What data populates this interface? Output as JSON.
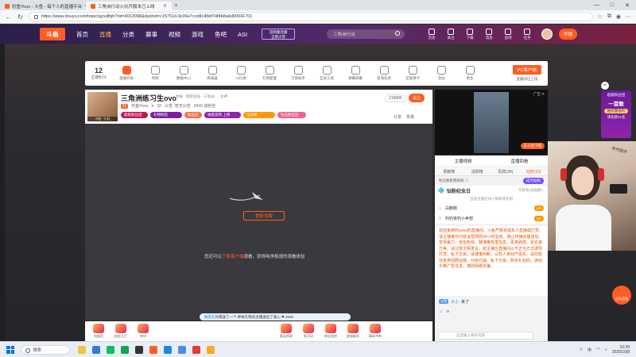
{
  "browser": {
    "tabs": [
      {
        "label": "钓鱼Yooo - 斗鱼 - 每个人的直播平台",
        "active": false
      },
      {
        "label": "三角洲行动火坑开服本已上线",
        "active": true
      }
    ],
    "url": "https://www.douyu.com/topic/sjzxdlhjh?rid=4913098&dyshid=c15751d-9c06e7ccd8c45bf74f4b8a6d00041701",
    "window_controls": [
      "—",
      "□",
      "✕"
    ]
  },
  "site": {
    "logo": "斗鱼",
    "nav": [
      "首页",
      "直播",
      "分类",
      "赛事",
      "视频",
      "游戏",
      "鱼吧",
      "ASI"
    ],
    "active_nav": "直播",
    "promo": [
      "官网重连播",
      "全职大赏"
    ],
    "search_placeholder": "三角洲行动",
    "header_icons": [
      "历史",
      "关注",
      "下载",
      "消息",
      "鱼吧",
      "任务"
    ],
    "live_button": "开播"
  },
  "toolbar": {
    "level": "12",
    "level_label": "主播积分",
    "tools": [
      "直播开关",
      "月榜",
      "数据中心",
      "降噪器",
      "AI礼物",
      "礼物配置",
      "刀锋助手",
      "互动工具",
      "弹幕屏幕",
      "星海任务",
      "正版弹卡",
      "活动",
      "更多"
    ],
    "pc_button": "PC客户端",
    "pc_sub": "直播间已上线"
  },
  "room": {
    "title": "三角洲练习生ovo",
    "tags": "举报 · 网游竞技 · 三角洲... · 女神",
    "level": "11",
    "streamer": "钓鱼Yooo",
    "hot": "32",
    "notice": "公告: 暂无公告",
    "followers": "3040 成粉丝",
    "thumb_label": "小吃 · 小礼",
    "badges": [
      "超级粉丝团",
      "礼物制造",
      "粉丝团",
      "福星高照 上榜",
      "全站榜",
      "钻石粉丝团"
    ],
    "fans_count": "218880",
    "follow_button": "关注",
    "share": "分享",
    "report": "举报"
  },
  "player": {
    "retry_button": "重新加载",
    "hint_prefix": "您还可以",
    "hint_link": "下载客户端",
    "hint_suffix": "观看，获得纯净极速的观看体验",
    "bubble_user": "群友孔颖",
    "bubble_text": "赠送了一个 神奇礼物 ",
    "bubble_tail": "向主播送出了爱心 ❤ 2025"
  },
  "gifts": [
    "抢福利",
    "粉丝大厅",
    "房间",
    "庆典",
    "活动",
    "星际探索",
    "新活动",
    "粉丝和他",
    "星城副本",
    "精彩冲刺"
  ],
  "ad": {
    "label": "广告 ✕",
    "button": "去斗鱼下载"
  },
  "panel": {
    "row1": [
      "主播视频",
      "直播回看"
    ],
    "tabs": [
      "贡献榜",
      "活跃榜",
      "贵宾(34)",
      "钻粉(63)"
    ],
    "active_tab": "钻粉(63)",
    "strip_text": "粉丝膨胀锦旗排 ⓘ",
    "strip_pill": "成为钻粉",
    "diamond_title": "钻粉纪念日",
    "diamond_right": "今日有1位钻粉 ›",
    "note": "当前主播在线人数和排名明",
    "rank": [
      {
        "n": "1",
        "name": "白鹏鹏",
        "tag": "VIP"
      },
      {
        "n": "2",
        "name": "钓钓夜钓小卖部",
        "tag": "VIP"
      }
    ],
    "notice": "欢迎来到钓yooo的直播间。斗鱼严禁未成年人直播或打赏。请主播遵守内容运营规则24小时监管，禁止传播封建迷信、宣扬暴力、低俗色情、赌博等有害信息，恶意刷屏、冒充官方等，请注意文明发言。如主播在直播间以不正当方式诱导打赏、私下交易，请谨慎判断，以防人身财产损失。请勿轻信各类招聘征婚、代练代抽、私下交易、购买礼包码、游戏币等广告信息，谨防网络诈骗。",
    "chat_user": "大小",
    "chat_text": "来了",
    "chat_tag": "斗鱼",
    "input_placeholder": "这里输入聊天内容"
  },
  "floating": {
    "event_title": "超级粉丝团",
    "event_big": "一首歌",
    "event_sub": "抽奖赢福利",
    "event_rank": "领先榜11名",
    "live_badge": "活动直播",
    "cam_text": "手作陪伴"
  },
  "taskbar": {
    "search": "搜索",
    "time": "10:28",
    "date": "2025/10/8",
    "lang": "中"
  }
}
